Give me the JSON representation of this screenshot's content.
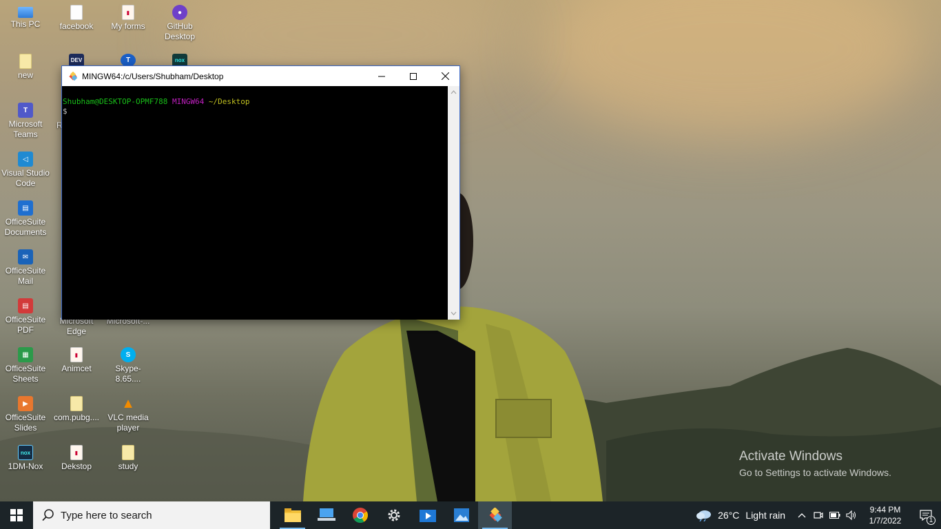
{
  "desktop": {
    "icons": [
      {
        "label": "This PC",
        "icon": "computer-icon"
      },
      {
        "label": "facebook",
        "icon": "document-icon"
      },
      {
        "label": "My forms",
        "icon": "pdf-document-icon"
      },
      {
        "label": "GitHub Desktop",
        "icon": "github-desktop-icon"
      },
      {
        "label": "new",
        "icon": "folder-icon"
      },
      {
        "label": "Microsoft Teams",
        "icon": "teams-icon"
      },
      {
        "label": "R",
        "icon": "app-icon"
      },
      {
        "label": "Visual Studio Code",
        "icon": "vscode-icon"
      },
      {
        "label": "OfficeSuite Documents",
        "icon": "officesuite-documents-icon"
      },
      {
        "label": "OfficeSuite Mail",
        "icon": "officesuite-mail-icon"
      },
      {
        "label": "OfficeSuite PDF",
        "icon": "officesuite-pdf-icon"
      },
      {
        "label": "Microsoft Edge",
        "icon": "edge-icon"
      },
      {
        "label": "Microsoft-...",
        "icon": "app-icon"
      },
      {
        "label": "OfficeSuite Sheets",
        "icon": "officesuite-sheets-icon"
      },
      {
        "label": "Animcet",
        "icon": "pdf-document-icon"
      },
      {
        "label": "Skype-8.65....",
        "icon": "skype-installer-icon"
      },
      {
        "label": "OfficeSuite Slides",
        "icon": "officesuite-slides-icon"
      },
      {
        "label": "com.pubg....",
        "icon": "folder-icon"
      },
      {
        "label": "VLC media player",
        "icon": "vlc-icon"
      },
      {
        "label": "1DM-Nox",
        "icon": "nox-icon"
      },
      {
        "label": "Dekstop",
        "icon": "pdf-document-icon"
      },
      {
        "label": "study",
        "icon": "folder-icon"
      }
    ]
  },
  "terminal": {
    "title": "MINGW64:/c/Users/Shubham/Desktop",
    "prompt_user": "Shubham@DESKTOP-OPMF788",
    "prompt_env": "MINGW64",
    "prompt_path": "~/Desktop",
    "prompt_symbol": "$"
  },
  "watermark": {
    "line1": "Activate Windows",
    "line2": "Go to Settings to activate Windows."
  },
  "taskbar": {
    "search_placeholder": "Type here to search",
    "apps": [
      "file-explorer-icon",
      "this-pc-icon",
      "chrome-icon",
      "settings-icon",
      "media-player-icon",
      "photos-icon",
      "git-bash-icon"
    ],
    "weather_temp": "26°C",
    "weather_desc": "Light rain",
    "time": "9:44 PM",
    "date": "1/7/2022",
    "notification_count": "1"
  },
  "colors": {
    "prompt_user": "#19c019",
    "prompt_env": "#c020c0",
    "prompt_path": "#c0c020",
    "taskbar_bg": "#1c2428",
    "window_border": "#3a66c4"
  }
}
